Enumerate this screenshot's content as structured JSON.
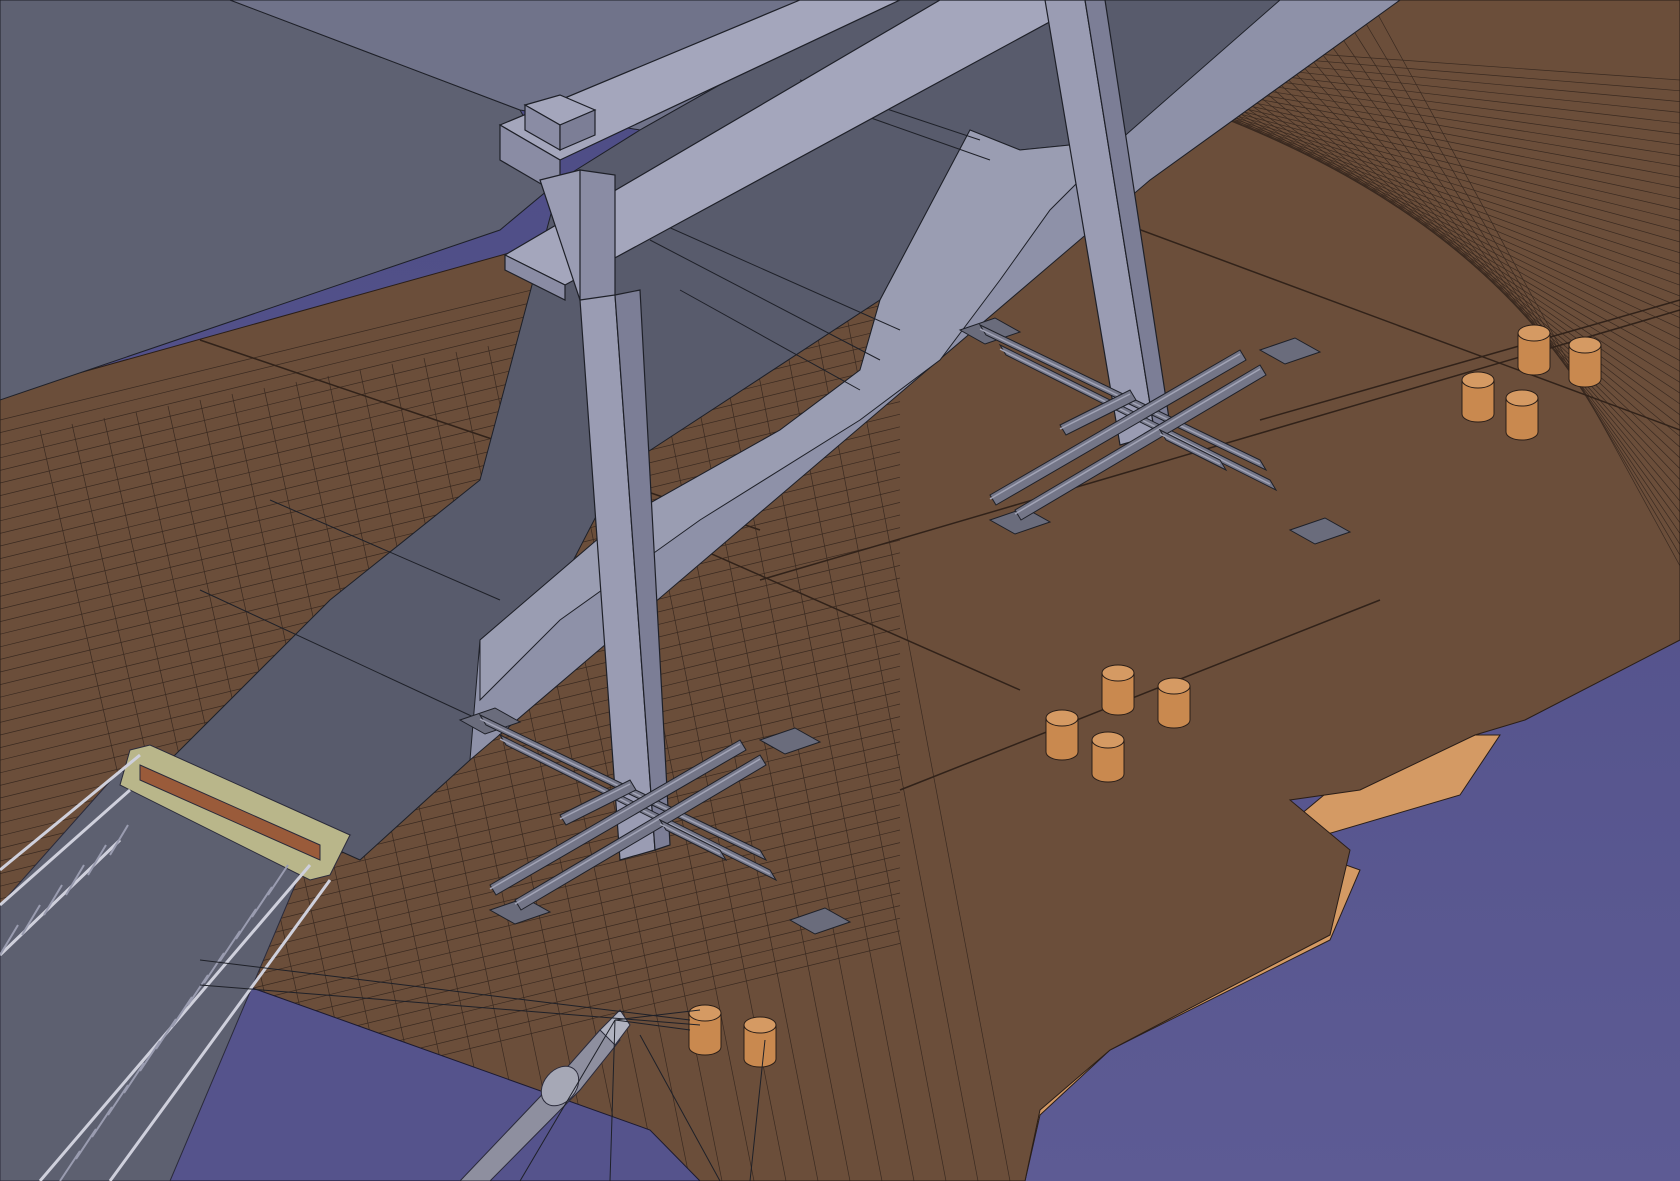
{
  "scene": {
    "colors": {
      "water": "#5a5890",
      "deck": "#6b4e3a",
      "deck_lit": "#d49a64",
      "hull": "#8e91a8",
      "hull_dark": "#555a6a",
      "frame": "#9799b0",
      "frame_shadow": "#7f819a",
      "bollard": "#d59a63",
      "steel": "#747688",
      "gangway": "#a2a4b5",
      "walkway_pad": "#b9b68a"
    },
    "objects": [
      "deck",
      "ship-hull",
      "portal-frame",
      "front-foundation-frame",
      "rear-foundation-frame",
      "bollards",
      "gangway",
      "crane-boom"
    ]
  }
}
